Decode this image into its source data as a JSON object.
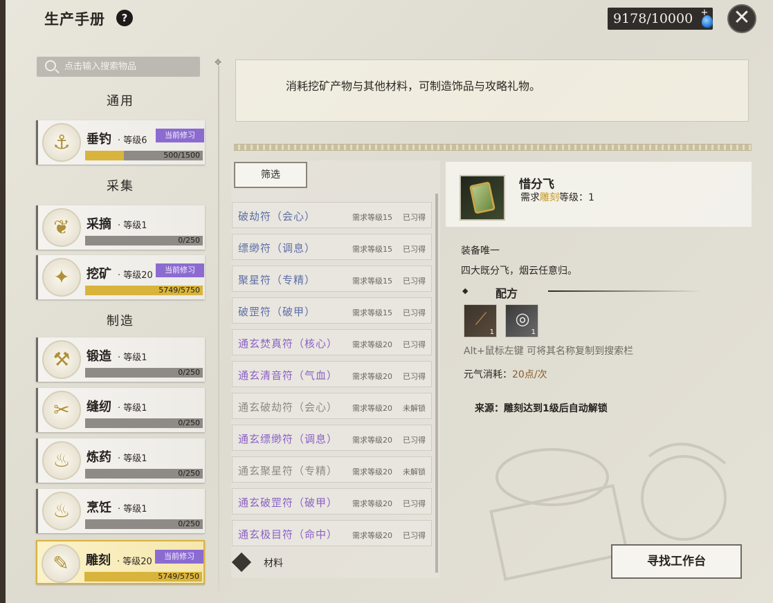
{
  "window": {
    "title": "生产手册",
    "help_icon": "?",
    "currency": "9178/10000",
    "currency_plus": "+",
    "close_icon": "✕"
  },
  "search": {
    "placeholder": "点击输入搜索物品"
  },
  "sections": {
    "general": "通用",
    "gather": "采集",
    "craft": "制造"
  },
  "skills": [
    {
      "name": "垂钓",
      "level": "· 等级6",
      "badge": "当前修习",
      "exp": "500/1500",
      "progress": 0.33,
      "icon": "fishing-icon",
      "glyph": "⚓"
    },
    {
      "name": "采摘",
      "level": "· 等级1",
      "badge": "",
      "exp": "0/250",
      "progress": 0,
      "icon": "leaf-icon",
      "glyph": "❦"
    },
    {
      "name": "挖矿",
      "level": "· 等级20",
      "badge": "当前修习",
      "exp": "5749/5750",
      "progress": 0.999,
      "icon": "ore-icon",
      "glyph": "✦"
    },
    {
      "name": "锻造",
      "level": "· 等级1",
      "badge": "",
      "exp": "0/250",
      "progress": 0,
      "icon": "anvil-icon",
      "glyph": "⚒"
    },
    {
      "name": "缝纫",
      "level": "· 等级1",
      "badge": "",
      "exp": "0/250",
      "progress": 0,
      "icon": "thread-icon",
      "glyph": "✂"
    },
    {
      "name": "炼药",
      "level": "· 等级1",
      "badge": "",
      "exp": "0/250",
      "progress": 0,
      "icon": "gourd-icon",
      "glyph": "♨"
    },
    {
      "name": "烹饪",
      "level": "· 等级1",
      "badge": "",
      "exp": "0/250",
      "progress": 0,
      "icon": "cooking-icon",
      "glyph": "♨"
    },
    {
      "name": "雕刻",
      "level": "· 等级20",
      "badge": "当前修习",
      "exp": "5749/5750",
      "progress": 0.999,
      "icon": "carving-icon",
      "glyph": "✎"
    }
  ],
  "description": "消耗挖矿产物与其他材料，可制造饰品与攻略礼物。",
  "filter_label": "筛选",
  "recipes": [
    {
      "name": "破劫符（会心）",
      "req": "需求等级15",
      "state": "已习得",
      "color": "blue"
    },
    {
      "name": "缥缈符（调息）",
      "req": "需求等级15",
      "state": "已习得",
      "color": "blue"
    },
    {
      "name": "聚星符（专精）",
      "req": "需求等级15",
      "state": "已习得",
      "color": "blue"
    },
    {
      "name": "破罡符（破甲）",
      "req": "需求等级15",
      "state": "已习得",
      "color": "blue"
    },
    {
      "name": "通玄焚真符（核心）",
      "req": "需求等级20",
      "state": "已习得",
      "color": "purple"
    },
    {
      "name": "通玄清音符（气血）",
      "req": "需求等级20",
      "state": "已习得",
      "color": "purple"
    },
    {
      "name": "通玄破劫符（会心）",
      "req": "需求等级20",
      "state": "未解锁",
      "color": "grey"
    },
    {
      "name": "通玄缥缈符（调息）",
      "req": "需求等级20",
      "state": "已习得",
      "color": "purple"
    },
    {
      "name": "通玄聚星符（专精）",
      "req": "需求等级20",
      "state": "未解锁",
      "color": "grey"
    },
    {
      "name": "通玄破罡符（破甲）",
      "req": "需求等级20",
      "state": "已习得",
      "color": "purple"
    },
    {
      "name": "通玄极目符（命中）",
      "req": "需求等级20",
      "state": "已习得",
      "color": "purple"
    }
  ],
  "materials_label": "材料",
  "detail": {
    "name": "惜分飞",
    "req_prefix": "需求",
    "req_skill": "雕刻",
    "req_suffix": "等级：1",
    "equip_unique": "装备唯一",
    "flavor": "四大既分飞，烟云任意归。",
    "recipe_title": "配方",
    "ingredients": [
      {
        "icon": "wood-icon",
        "count": "1"
      },
      {
        "icon": "rope-icon",
        "count": "1"
      }
    ],
    "copy_hint": "Alt+鼠标左键 可将其名称复制到搜索栏",
    "energy_label": "元气消耗：",
    "energy_value": "20点/次",
    "source": "来源：雕刻达到1级后自动解锁"
  },
  "find_button": "寻找工作台",
  "colors": {
    "accent_gold": "#d9b43d",
    "badge_purple": "#8c6bd1",
    "recipe_blue": "#5d6fa6",
    "recipe_purple": "#8b62c4",
    "recipe_grey": "#8d8a84"
  }
}
